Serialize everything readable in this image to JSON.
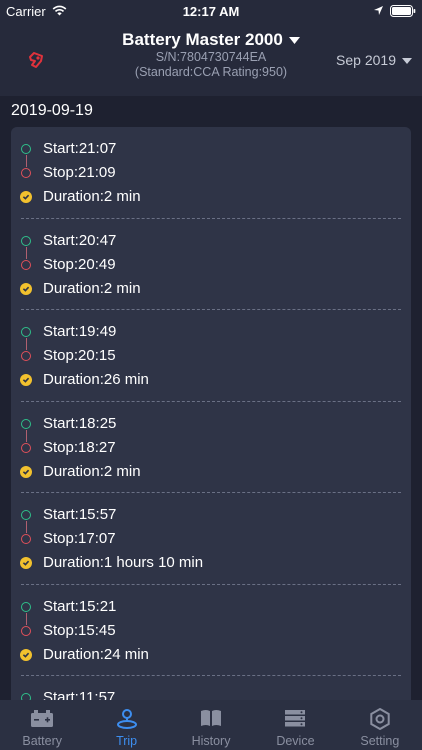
{
  "status_bar": {
    "carrier": "Carrier",
    "time": "12:17 AM"
  },
  "header": {
    "title": "Battery Master 2000",
    "serial": "S/N:7804730744EA",
    "spec": "(Standard:CCA  Rating:950)",
    "month": "Sep 2019"
  },
  "content": {
    "date": "2019-09-19",
    "trips": [
      {
        "start": "Start:21:07",
        "stop": "Stop:21:09",
        "duration": "Duration:2 min"
      },
      {
        "start": "Start:20:47",
        "stop": "Stop:20:49",
        "duration": "Duration:2 min"
      },
      {
        "start": "Start:19:49",
        "stop": "Stop:20:15",
        "duration": "Duration:26 min"
      },
      {
        "start": "Start:18:25",
        "stop": "Stop:18:27",
        "duration": "Duration:2 min"
      },
      {
        "start": "Start:15:57",
        "stop": "Stop:17:07",
        "duration": "Duration:1 hours 10 min"
      },
      {
        "start": "Start:15:21",
        "stop": "Stop:15:45",
        "duration": "Duration:24 min"
      },
      {
        "start": "Start:11:57",
        "stop": "",
        "duration": ""
      }
    ]
  },
  "tabs": [
    {
      "label": "Battery",
      "icon": "battery-icon"
    },
    {
      "label": "Trip",
      "icon": "trip-icon"
    },
    {
      "label": "History",
      "icon": "history-book-icon"
    },
    {
      "label": "Device",
      "icon": "device-icon"
    },
    {
      "label": "Setting",
      "icon": "gear-icon"
    }
  ],
  "colors": {
    "start": "#2fbf8a",
    "stop": "#e0505a",
    "duration": "#f2c12e",
    "active_tab": "#3d8ef0"
  }
}
